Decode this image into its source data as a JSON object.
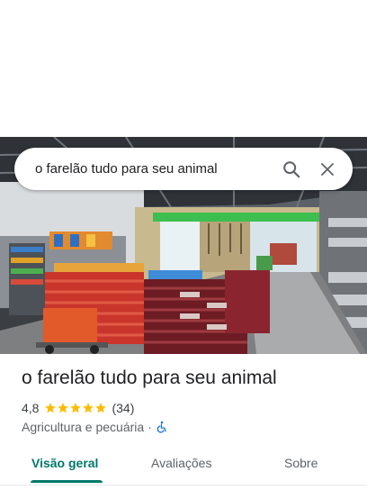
{
  "search": {
    "query": "o farelão tudo para seu animal",
    "search_icon": "search-icon",
    "close_icon": "close-icon"
  },
  "photo": {
    "description_icon": "storefront-photo"
  },
  "place": {
    "name": "o farelão tudo para seu animal",
    "rating": "4,8",
    "stars": 5,
    "reviews": "(34)",
    "category": "Agricultura e pecuária",
    "separator": "·",
    "accessibility_icon": "wheelchair-icon"
  },
  "tabs": [
    {
      "label": "Visão geral",
      "active": true
    },
    {
      "label": "Avaliações",
      "active": false
    },
    {
      "label": "Sobre",
      "active": false
    }
  ],
  "colors": {
    "accent": "#00796b",
    "star": "#fbbc04",
    "accessibility": "#1a73e8"
  }
}
